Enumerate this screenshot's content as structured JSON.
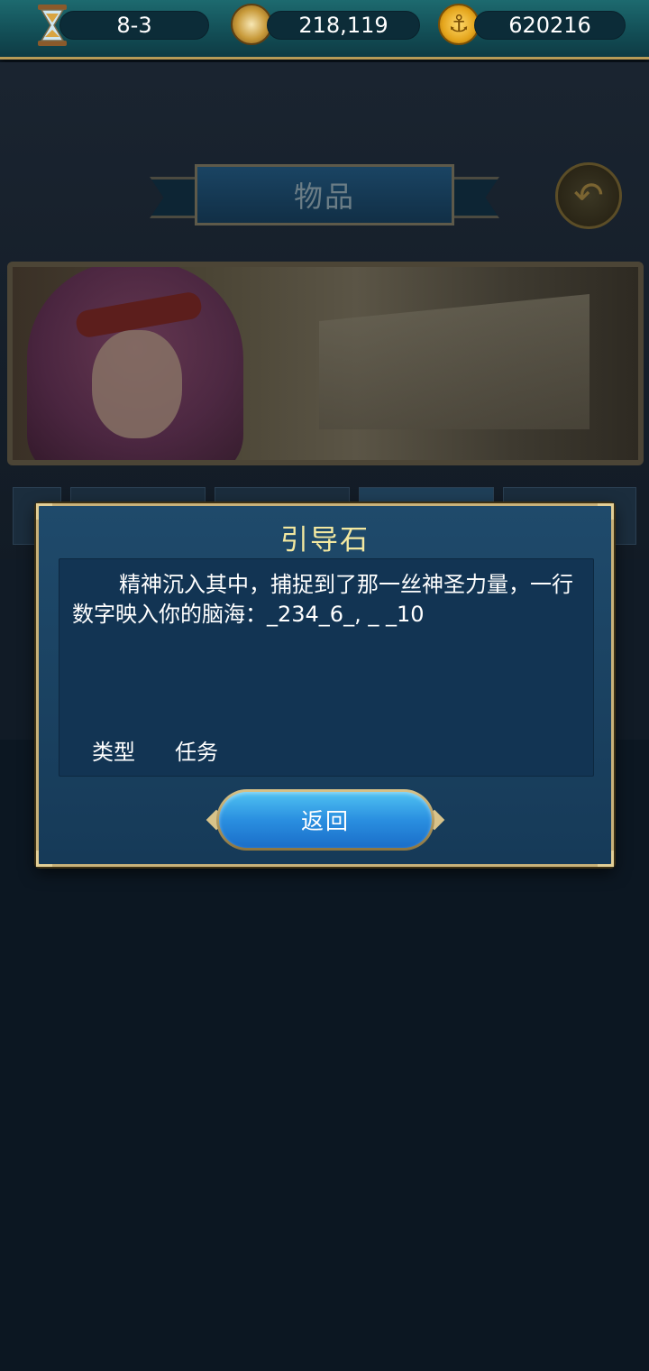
{
  "topbar": {
    "stage": "8-3",
    "compass_value": "218,119",
    "coin_value": "620216",
    "icons": [
      "hourglass-icon",
      "compass-icon",
      "anchor-coin-icon"
    ]
  },
  "page": {
    "title": "物品",
    "back_icon": "return-arrow-icon"
  },
  "modal": {
    "title": "引导石",
    "description": "精神沉入其中，捕捉到了那一丝神圣力量，一行数字映入你的脑海：_234_6_, _ _10",
    "type_label": "类型",
    "type_value": "任务",
    "return_label": "返回"
  },
  "colors": {
    "title_yellow": "#f3e8a0",
    "modal_bg": "#1f4a6b",
    "gold_border": "#c9b27a",
    "button_blue": "#2a8fe0"
  }
}
